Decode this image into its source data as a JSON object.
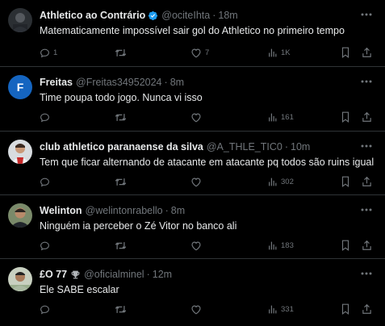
{
  "colors": {
    "background": "#000000",
    "text": "#e7e9ea",
    "muted": "#71767b",
    "divider": "#2f3336",
    "verified": "#1d9bf0",
    "avatar_f": "#1565c0"
  },
  "tweets": [
    {
      "name": "Athletico ao Contrário",
      "verified": true,
      "handle": "@ociteIhta",
      "time": "18m",
      "text": "Matematicamente impossível sair gol do Athletico no primeiro tempo",
      "replies": "1",
      "retweets": "",
      "likes": "7",
      "views": "1K",
      "avatar_icon": "avatar-photo-icon"
    },
    {
      "name": "Freitas",
      "verified": false,
      "handle": "@Freitas34952024",
      "time": "8m",
      "text": "Time poupa todo jogo. Nunca vi isso",
      "replies": "",
      "retweets": "",
      "likes": "",
      "views": "161",
      "avatar_letter": "F"
    },
    {
      "name": "club athletico paranaense da silva",
      "verified": false,
      "handle": "@A_THLE_TIC0",
      "time": "10m",
      "text": "Tem que ficar alternando de atacante em atacante pq todos são ruins igual",
      "replies": "",
      "retweets": "",
      "likes": "",
      "views": "302",
      "avatar_icon": "avatar-photo-icon"
    },
    {
      "name": "Welinton",
      "verified": false,
      "handle": "@welintonrabello",
      "time": "8m",
      "text": "Ninguém ia perceber o Zé Vitor no banco ali",
      "replies": "",
      "retweets": "",
      "likes": "",
      "views": "183",
      "avatar_icon": "avatar-photo-icon"
    },
    {
      "name": "£O 77",
      "verified": false,
      "handle": "@oficialminel",
      "time": "12m",
      "text": "Ele SABE escalar",
      "replies": "",
      "retweets": "",
      "likes": "",
      "views": "331",
      "avatar_icon": "avatar-photo-icon",
      "name_badge_icon": "trophy-icon"
    }
  ],
  "separator": "·"
}
